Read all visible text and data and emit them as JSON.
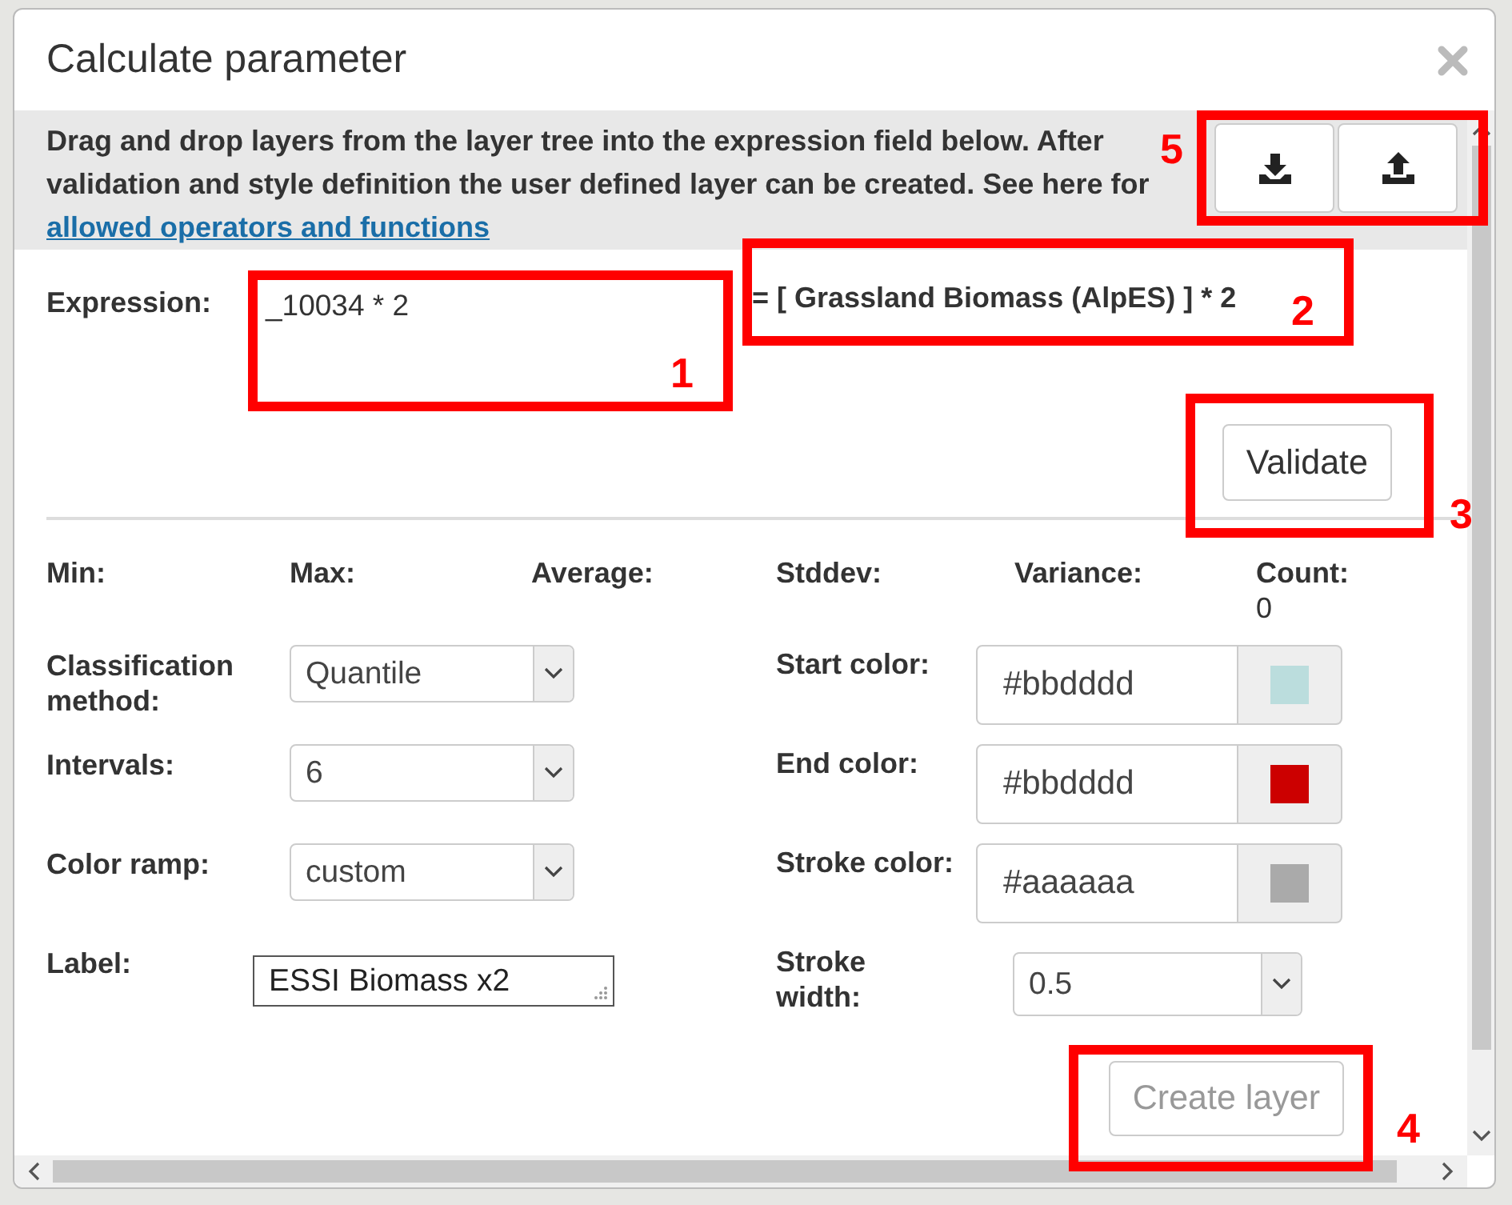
{
  "window": {
    "title": "Calculate parameter"
  },
  "info": {
    "text": "Drag and drop layers from the layer tree into the expression field below. After validation and style definition the user defined layer can be created. See here for",
    "link": "allowed operators and functions"
  },
  "toolbar": [
    {
      "kind": "download"
    },
    {
      "kind": "upload"
    }
  ],
  "expression": {
    "label": "Expression:",
    "value": "_10034 * 2",
    "parsed": "= [ Grassland Biomass (AlpES) ] * 2"
  },
  "validate_button": {
    "label": "Validate"
  },
  "stats": [
    {
      "label": "Min:"
    },
    {
      "label": "Max:"
    },
    {
      "label": "Average:"
    },
    {
      "label": "Stddev:"
    },
    {
      "label": "Variance:"
    },
    {
      "label": "Count:",
      "value": "0"
    }
  ],
  "left_fields": [
    {
      "kind": "select",
      "label": "Classification method:",
      "value": "Quantile"
    },
    {
      "kind": "select",
      "label": "Intervals:",
      "value": "6"
    },
    {
      "kind": "select",
      "label": "Color ramp:",
      "value": "custom"
    },
    {
      "kind": "text",
      "label": "Label:",
      "value": "ESSI Biomass x2"
    }
  ],
  "right_fields": [
    {
      "kind": "color",
      "label": "Start color:",
      "value": "#bbdddd",
      "color": "#bbdddd"
    },
    {
      "kind": "color",
      "label": "End color:",
      "value": "#bbdddd",
      "color": "#cc0000"
    },
    {
      "kind": "color",
      "label": "Stroke color:",
      "value": "#aaaaaa",
      "color": "#aaaaaa"
    },
    {
      "kind": "select",
      "label": "Stroke width:",
      "value": "0.5"
    }
  ],
  "create_button": {
    "label": "Create layer",
    "disabled": true
  },
  "annotations": [
    {
      "label": "1"
    },
    {
      "label": "2"
    },
    {
      "label": "3"
    },
    {
      "label": "4"
    },
    {
      "label": "5"
    }
  ]
}
